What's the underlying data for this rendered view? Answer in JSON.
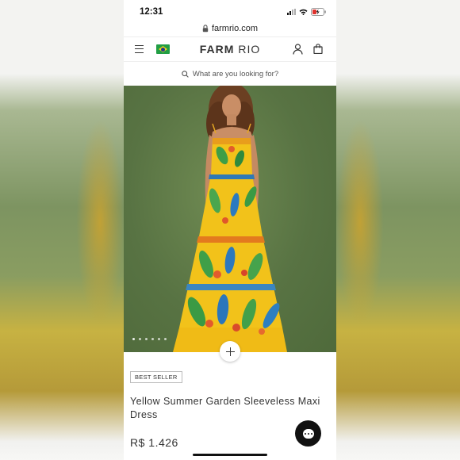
{
  "status_bar": {
    "time": "12:31"
  },
  "browser": {
    "url": "farmrio.com"
  },
  "header": {
    "logo_strong": "FARM",
    "logo_light": " RIO"
  },
  "search": {
    "placeholder": "What are you looking for?"
  },
  "gallery": {
    "image_count": 6,
    "current_index": 1
  },
  "product": {
    "badge": "BEST SELLER",
    "title": "Yellow Summer Garden Sleeveless Maxi Dress",
    "price": "R$ 1.426"
  },
  "colors": {
    "dress_yellow": "#f2c21a",
    "background_green": "#587343",
    "chat_button": "#111111"
  }
}
